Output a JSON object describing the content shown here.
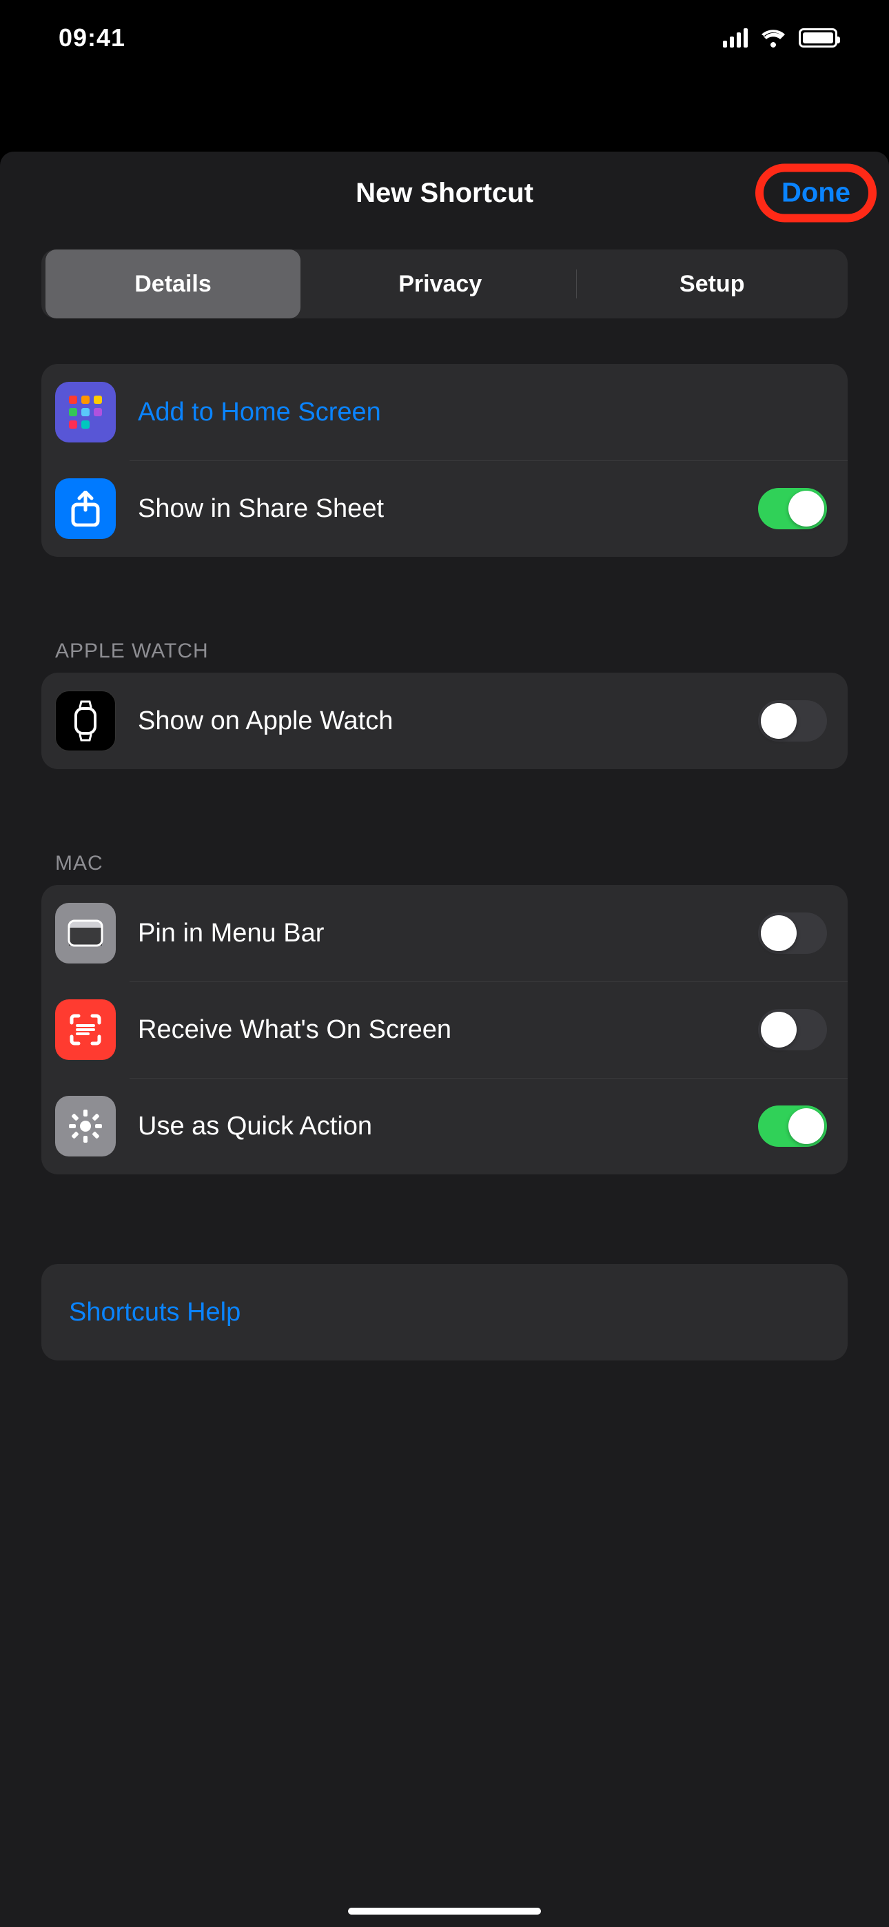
{
  "status": {
    "time": "09:41"
  },
  "sheet": {
    "title": "New Shortcut",
    "done": "Done",
    "tabs": {
      "details": "Details",
      "privacy": "Privacy",
      "setup": "Setup",
      "selected": "Details"
    }
  },
  "rows": {
    "add_home": "Add to Home Screen",
    "share_sheet": "Show in Share Sheet",
    "apple_watch_header": "Apple Watch",
    "show_watch": "Show on Apple Watch",
    "mac_header": "Mac",
    "pin_menubar": "Pin in Menu Bar",
    "receive_screen": "Receive What's On Screen",
    "quick_action": "Use as Quick Action",
    "help": "Shortcuts Help"
  },
  "toggles": {
    "share_sheet": true,
    "show_watch": false,
    "pin_menubar": false,
    "receive_screen": false,
    "quick_action": true
  },
  "colors": {
    "accent": "#0a84ff",
    "toggle_on": "#30d158",
    "highlight_ring": "#ff2a17"
  }
}
